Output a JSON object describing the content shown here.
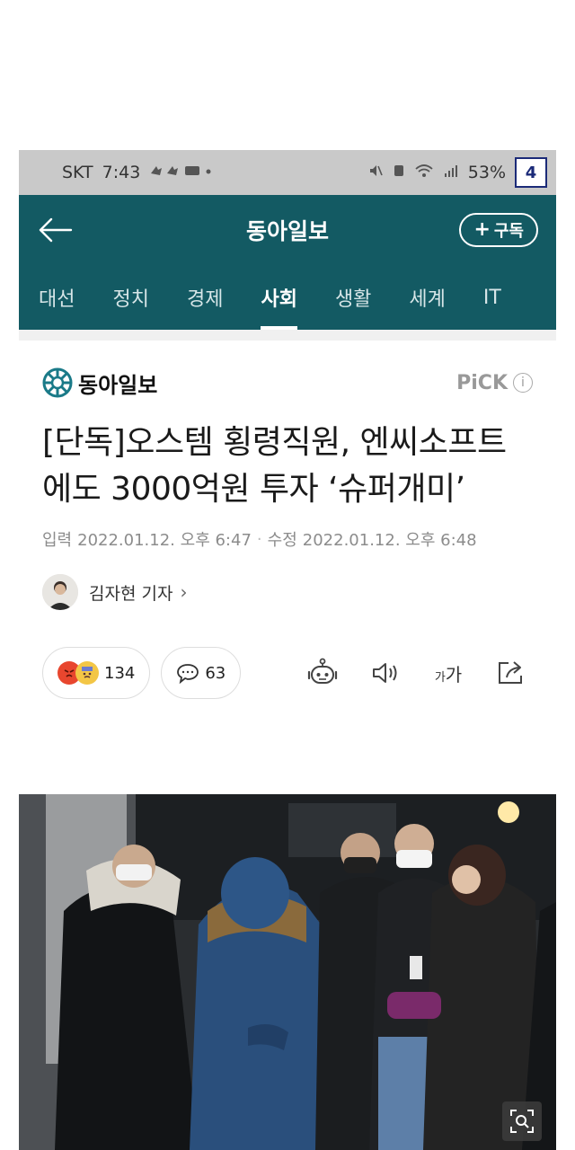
{
  "status_bar": {
    "carrier": "SKT",
    "time": "7:43",
    "battery": "53%",
    "page_badge": "4"
  },
  "app_bar": {
    "title": "동아일보",
    "subscribe_label": "구독",
    "subscribe_prefix": "+"
  },
  "tabs": [
    {
      "label": "대선",
      "active": false
    },
    {
      "label": "정치",
      "active": false
    },
    {
      "label": "경제",
      "active": false
    },
    {
      "label": "사회",
      "active": true
    },
    {
      "label": "생활",
      "active": false
    },
    {
      "label": "세계",
      "active": false
    },
    {
      "label": "IT",
      "active": false
    }
  ],
  "article": {
    "brand_name": "동아일보",
    "pick_label": "PiCK",
    "pick_info": "i",
    "headline": "[단독]오스템 횡령직원, 엔씨소프트에도 3000억원 투자 ‘슈퍼개미’",
    "published_label": "입력",
    "published": "2022.01.12. 오후 6:47",
    "modified_label": "수정",
    "modified": "2022.01.12. 오후 6:48",
    "author": "김자현 기자",
    "author_chevron": "›",
    "reaction_count": "134",
    "comment_count": "63",
    "font_size_label_small": "가",
    "font_size_label_large": "가"
  },
  "icons": [
    "back-arrow-icon",
    "plus-icon",
    "dongA-logo-icon",
    "info-icon",
    "angry-face-icon",
    "sad-face-icon",
    "comment-icon",
    "robot-reader-icon",
    "speaker-icon",
    "font-size-icon",
    "share-icon",
    "zoom-icon"
  ],
  "colors": {
    "header_bg": "#135a63",
    "status_bar_bg": "#c9c9c9",
    "logo_teal": "#1a7a88"
  }
}
